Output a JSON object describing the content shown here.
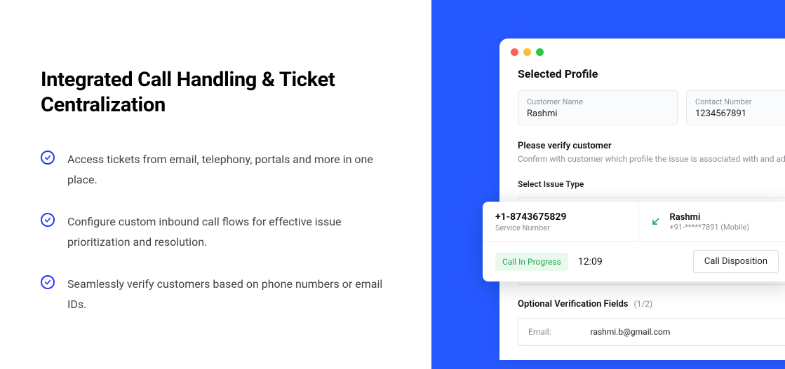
{
  "left": {
    "heading": "Integrated Call Handling & Ticket Centralization",
    "features": [
      "Access tickets from email, telephony, portals and more in one place.",
      "Configure custom inbound call flows for effective issue prioritization and resolution.",
      "Seamlessly verify customers based on phone numbers or email IDs."
    ]
  },
  "window": {
    "selected_profile_title": "Selected Profile",
    "customer_name_label": "Customer Name",
    "customer_name_value": "Rashmi",
    "contact_number_label": "Contact Number",
    "contact_number_value": "1234567891",
    "verify_title": "Please verify customer",
    "verify_desc": "Confirm with customer which profile the issue is associated with and ad",
    "select_issue_label": "Select Issue Type",
    "optional_title": "Optional Verification Fields",
    "optional_count": "(1/2)",
    "email_label": "Email:",
    "email_value": "rashmi.b@gmail.com"
  },
  "call": {
    "service_number": "+1-8743675829",
    "service_label": "Service Number",
    "contact_name": "Rashmi",
    "contact_number": "+91-*****7891 (Mobile)",
    "status": "Call In Progress",
    "timer": "12:09",
    "disposition_label": "Call Disposition"
  },
  "colors": {
    "accent": "#2659ff",
    "check": "#2539f9",
    "success": "#1fa955"
  }
}
